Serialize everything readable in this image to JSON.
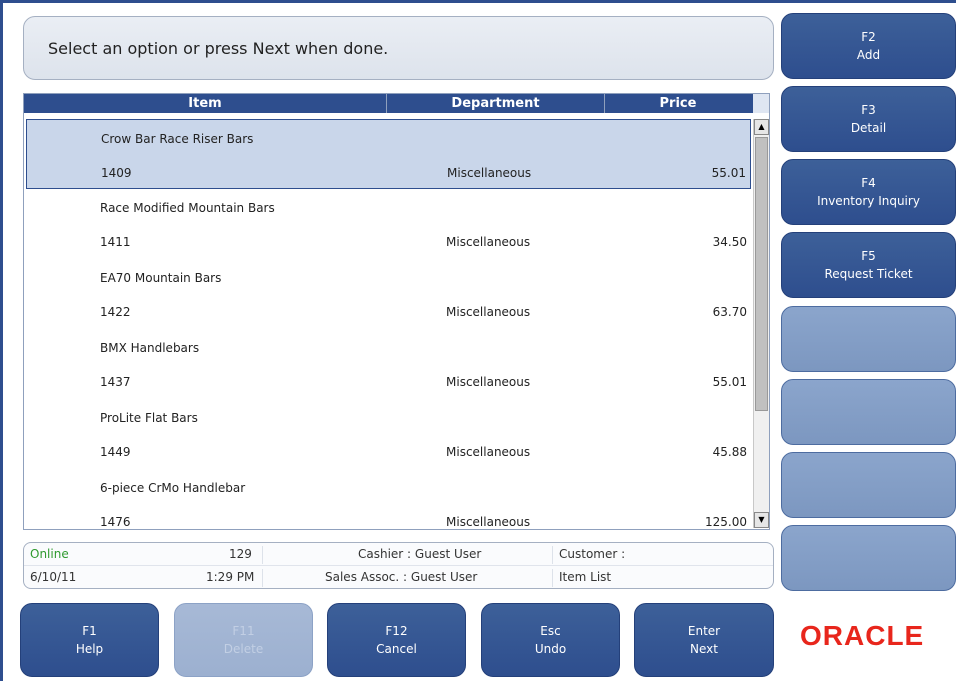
{
  "prompt": "Select an option or press Next when done.",
  "table": {
    "headers": [
      "Item",
      "Department",
      "Price"
    ],
    "rows": [
      {
        "name": "Crow Bar Race Riser Bars",
        "number": "1409",
        "department": "Miscellaneous",
        "price": "55.01",
        "selected": true
      },
      {
        "name": "Race Modified Mountain Bars",
        "number": "1411",
        "department": "Miscellaneous",
        "price": "34.50"
      },
      {
        "name": "EA70 Mountain Bars",
        "number": "1422",
        "department": "Miscellaneous",
        "price": "63.70"
      },
      {
        "name": "BMX Handlebars",
        "number": "1437",
        "department": "Miscellaneous",
        "price": "55.01"
      },
      {
        "name": "ProLite Flat Bars",
        "number": "1449",
        "department": "Miscellaneous",
        "price": "45.88"
      },
      {
        "name": "6-piece CrMo Handlebar",
        "number": "1476",
        "department": "Miscellaneous",
        "price": "125.00"
      }
    ]
  },
  "side_buttons": [
    {
      "key": "F2",
      "label": "Add"
    },
    {
      "key": "F3",
      "label": "Detail"
    },
    {
      "key": "F4",
      "label": "Inventory Inquiry"
    },
    {
      "key": "F5",
      "label": "Request Ticket"
    },
    {
      "key": "",
      "label": ""
    },
    {
      "key": "",
      "label": ""
    },
    {
      "key": "",
      "label": ""
    },
    {
      "key": "",
      "label": ""
    }
  ],
  "status": {
    "connection": "Online",
    "register": "129",
    "cashier": "Cashier : Guest User",
    "customer": "Customer :",
    "date": "6/10/11",
    "time": "1:29 PM",
    "sales_assoc": "Sales Assoc. : Guest User",
    "screen": "Item List"
  },
  "bottom_buttons": [
    {
      "key": "F1",
      "label": "Help",
      "disabled": false
    },
    {
      "key": "F11",
      "label": "Delete",
      "disabled": true
    },
    {
      "key": "F12",
      "label": "Cancel",
      "disabled": false
    },
    {
      "key": "Esc",
      "label": "Undo",
      "disabled": false
    },
    {
      "key": "Enter",
      "label": "Next",
      "disabled": false
    }
  ],
  "logo": "ORACLE",
  "colors": {
    "accent": "#2e4e8e",
    "logo": "#e8261c",
    "online": "#2f9a2f"
  }
}
